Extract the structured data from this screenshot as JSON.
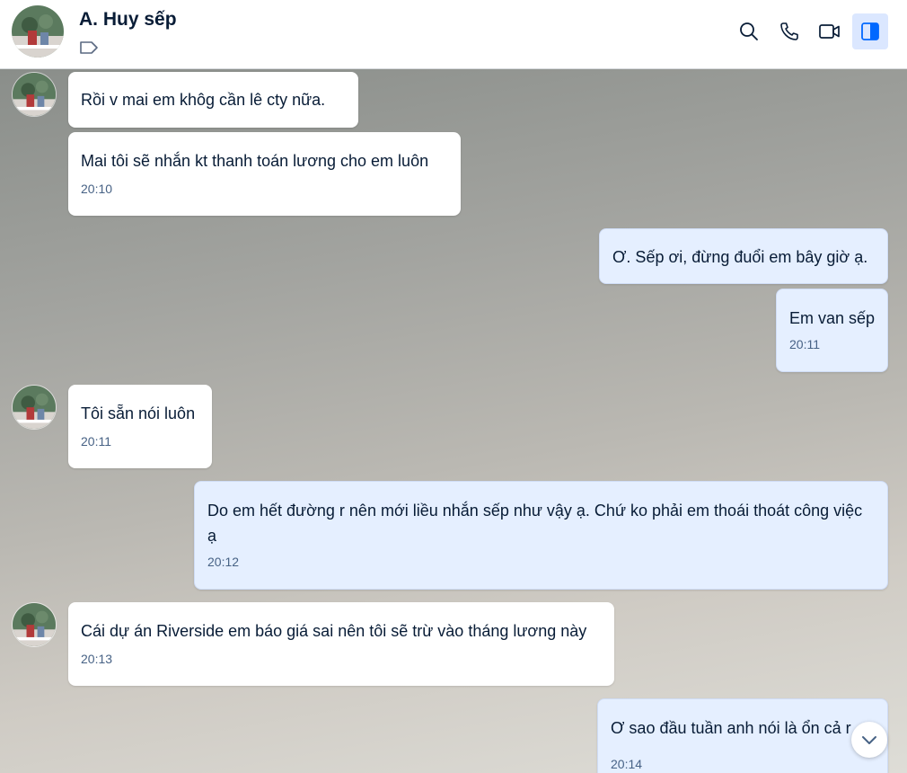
{
  "header": {
    "contact_name": "A. Huy sếp",
    "icons": [
      "label-tag-icon",
      "search-icon",
      "phone-icon",
      "video-call-icon",
      "sidebar-toggle-icon"
    ]
  },
  "messages": [
    {
      "sender": "contact",
      "text": "Rồi v mai em khôg cần lê cty nữa.",
      "time": ""
    },
    {
      "sender": "contact",
      "text": "Mai tôi sẽ nhắn kt thanh toán lương cho em luôn",
      "time": "20:10"
    },
    {
      "sender": "me",
      "text": "Ơ. Sếp ơi, đừng đuổi em bây giờ ạ.",
      "time": ""
    },
    {
      "sender": "me",
      "text": "Em van sếp",
      "time": "20:11"
    },
    {
      "sender": "contact",
      "text": "Tôi sẵn nói luôn",
      "time": "20:11"
    },
    {
      "sender": "me",
      "text": "Do em hết đường r nên mới liều nhắn sếp như vậy ạ. Chứ ko phải em thoái thoát công việc ạ",
      "time": "20:12"
    },
    {
      "sender": "contact",
      "text": "Cái dự án Riverside em báo giá sai nên tôi sẽ trừ vào tháng lương này",
      "time": "20:13"
    },
    {
      "sender": "me",
      "text": "Ơ sao đầu tuần anh nói là ổn cả r",
      "time": "20:14"
    }
  ],
  "colors": {
    "incoming_bubble": "#ffffff",
    "outgoing_bubble": "#e5efff",
    "text": "#081c36",
    "timestamp": "#476285",
    "accent": "#0068ff"
  }
}
